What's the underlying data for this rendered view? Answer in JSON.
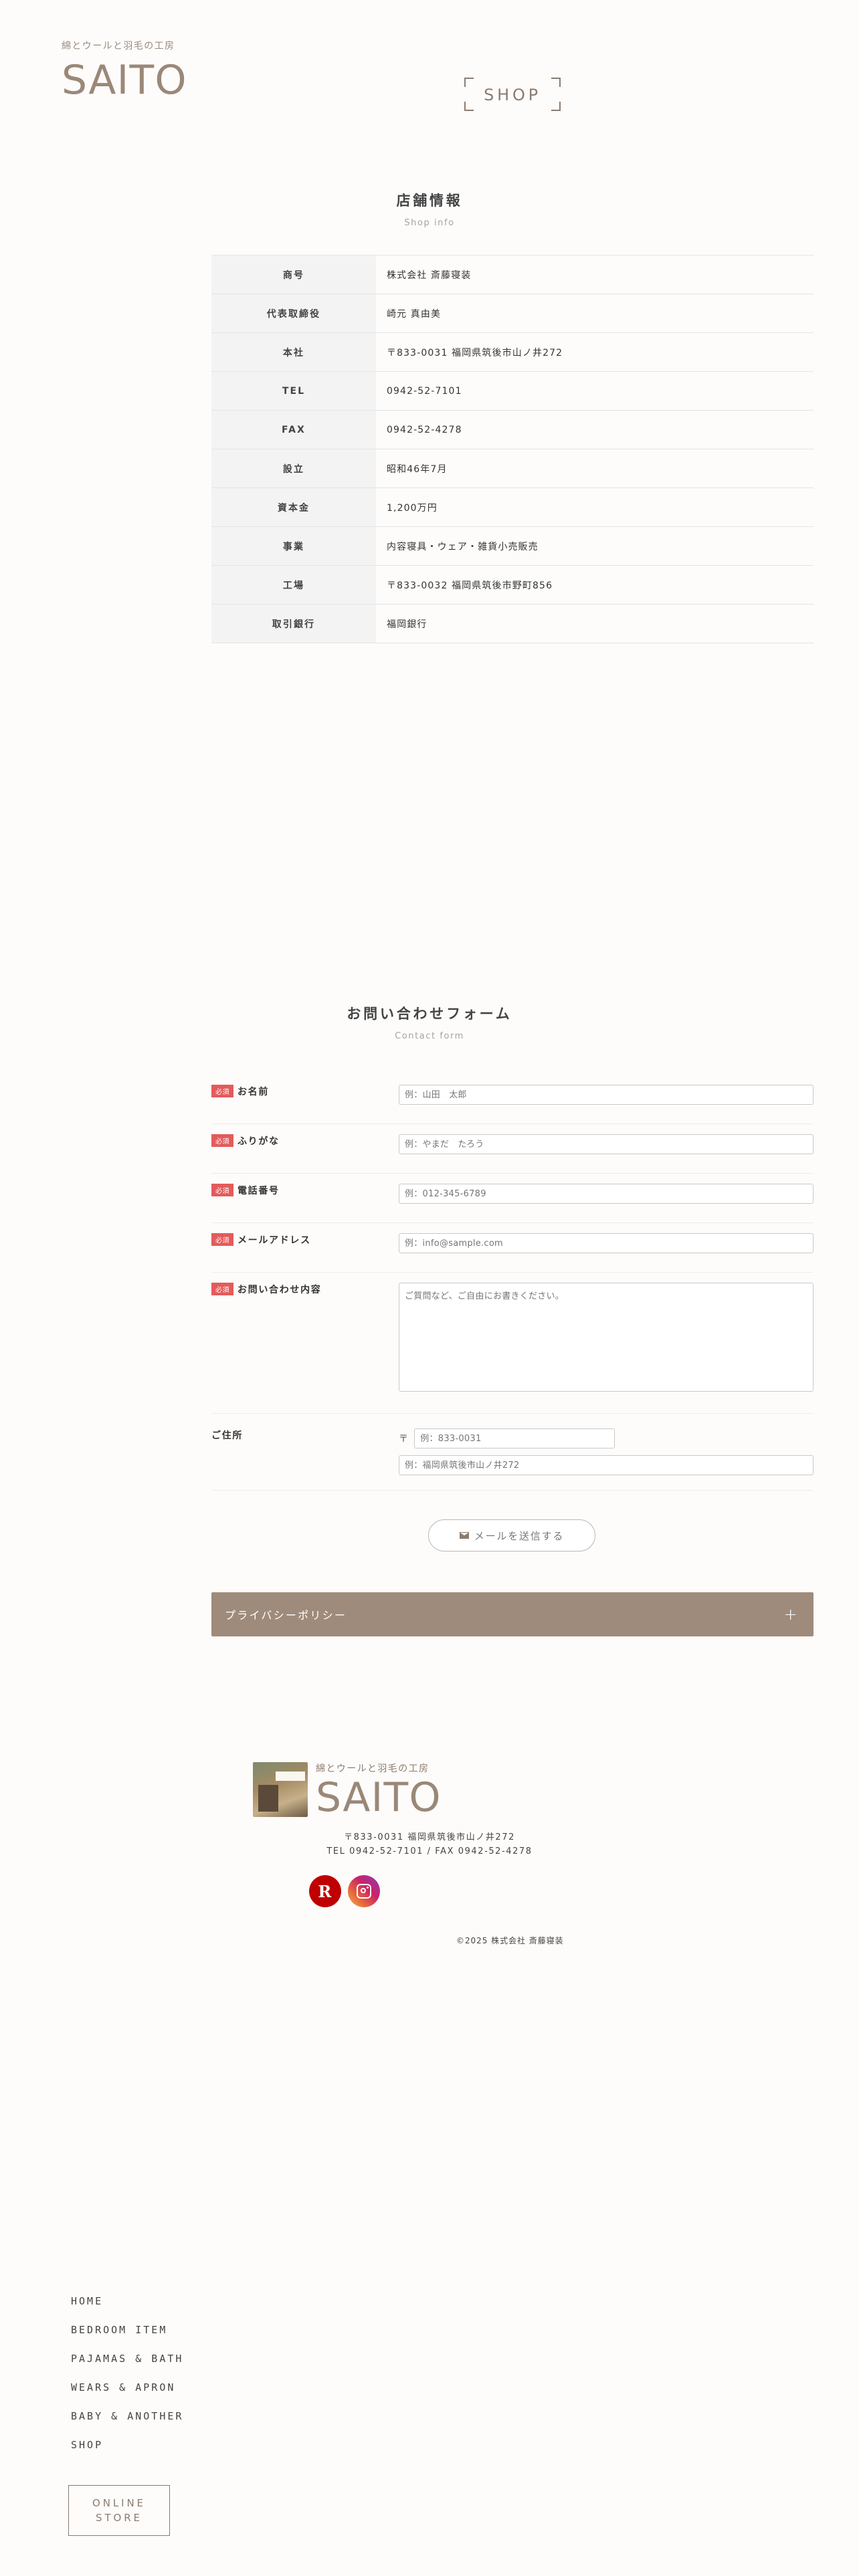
{
  "header": {
    "tagline": "綿とウールと羽毛の工房",
    "logo": "SAITO",
    "page_title": "SHOP"
  },
  "shop_info": {
    "title": "店舗情報",
    "subtitle": "Shop info",
    "rows": [
      {
        "label": "商号",
        "value": "株式会社 斎藤寝装"
      },
      {
        "label": "代表取締役",
        "value": "崎元 真由美"
      },
      {
        "label": "本社",
        "value": "〒833-0031 福岡県筑後市山ノ井272"
      },
      {
        "label": "TEL",
        "value": "0942-52-7101"
      },
      {
        "label": "FAX",
        "value": "0942-52-4278"
      },
      {
        "label": "設立",
        "value": "昭和46年7月"
      },
      {
        "label": "資本金",
        "value": "1,200万円"
      },
      {
        "label": "事業",
        "value": "内容寝具・ウェア・雑貨小売販売"
      },
      {
        "label": "工場",
        "value": "〒833-0032 福岡県筑後市野町856"
      },
      {
        "label": "取引銀行",
        "value": "福岡銀行"
      }
    ]
  },
  "contact": {
    "title": "お問い合わせフォーム",
    "subtitle": "Contact form",
    "required_badge": "必須",
    "fields": {
      "name": {
        "label": "お名前",
        "placeholder": "例：山田　太郎"
      },
      "kana": {
        "label": "ふりがな",
        "placeholder": "例：やまだ　たろう"
      },
      "phone": {
        "label": "電話番号",
        "placeholder": "例：012-345-6789"
      },
      "email": {
        "label": "メールアドレス",
        "placeholder": "例：info@sample.com"
      },
      "message": {
        "label": "お問い合わせ内容",
        "placeholder": "ご質問など、ご自由にお書きください。"
      },
      "address": {
        "label": "ご住所",
        "zip_mark": "〒",
        "zip_placeholder": "例：833-0031",
        "addr_placeholder": "例：福岡県筑後市山ノ井272"
      }
    },
    "submit_label": "メールを送信する",
    "privacy_label": "プライバシーポリシー",
    "privacy_toggle": "+"
  },
  "footer": {
    "tagline": "綿とウールと羽毛の工房",
    "logo": "SAITO",
    "address": "〒833-0031 福岡県筑後市山ノ井272",
    "tel_fax": "TEL 0942-52-7101 / FAX 0942-52-4278",
    "rakuten_letter": "R",
    "copyright": "©2025 株式会社 斎藤寝装"
  },
  "nav": {
    "items": [
      "HOME",
      "BEDROOM ITEM",
      "PAJAMAS & BATH",
      "WEARS & APRON",
      "BABY & ANOTHER",
      "SHOP"
    ],
    "online_line1": "ONLINE",
    "online_line2": "STORE"
  },
  "colors": {
    "brand": "#9a8878",
    "privacy_bar": "#9f8b7b",
    "required": "#e35b5b",
    "rakuten": "#bf0000"
  }
}
